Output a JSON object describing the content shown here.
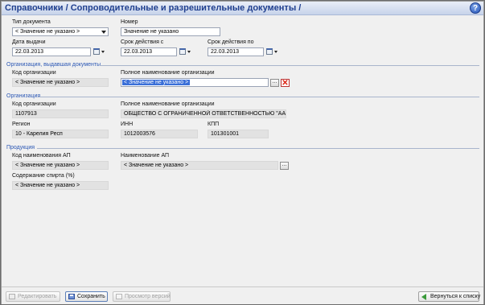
{
  "header": {
    "title": "Справочники / Сопроводительные и разрешительные документы /",
    "help_icon": "question-circle-icon",
    "help_glyph": "?"
  },
  "document": {
    "type_label": "Тип документа",
    "type_value": "< Значение не указано >",
    "number_label": "Номер",
    "number_value": "Значение не указано",
    "issue_date_label": "Дата выдачи",
    "issue_date_value": "22.03.2013",
    "valid_from_label": "Срок действия с",
    "valid_from_value": "22.03.2013",
    "valid_to_label": "Срок действия по",
    "valid_to_value": "22.03.2013"
  },
  "issuer": {
    "section_title": "Организация, выдавшая документы",
    "code_label": "Код организации",
    "code_value": "< Значение не указано >",
    "name_label": "Полное наименование организации",
    "name_value": "< Значение не указано >",
    "browse_label": "...",
    "clear_label": "✕"
  },
  "organization": {
    "section_title": "Организация",
    "code_label": "Код организации",
    "code_value": "1107913",
    "name_label": "Полное наименование организации",
    "name_value": "ОБЩЕСТВО С ОГРАНИЧЕННОЙ ОТВЕТСТВЕННОСТЬЮ \"ААЛТО\"",
    "region_label": "Регион",
    "region_value": "10 - Карелия Респ",
    "inn_label": "ИНН",
    "inn_value": "1012003576",
    "kpp_label": "КПП",
    "kpp_value": "101301001"
  },
  "product": {
    "section_title": "Продукция",
    "ap_code_label": "Код наименования АП",
    "ap_code_value": "< Значение не указано >",
    "ap_name_label": "Наименование АП",
    "ap_name_value": "< Значение не указано >",
    "browse_label": "...",
    "spirit_label": "Содержание спирта (%)",
    "spirit_value": "< Значение не указано >"
  },
  "toolbar": {
    "edit_label": "Редактировать",
    "save_label": "Сохранить",
    "history_label": "Просмотр версий",
    "back_label": "Вернуться к списку"
  }
}
